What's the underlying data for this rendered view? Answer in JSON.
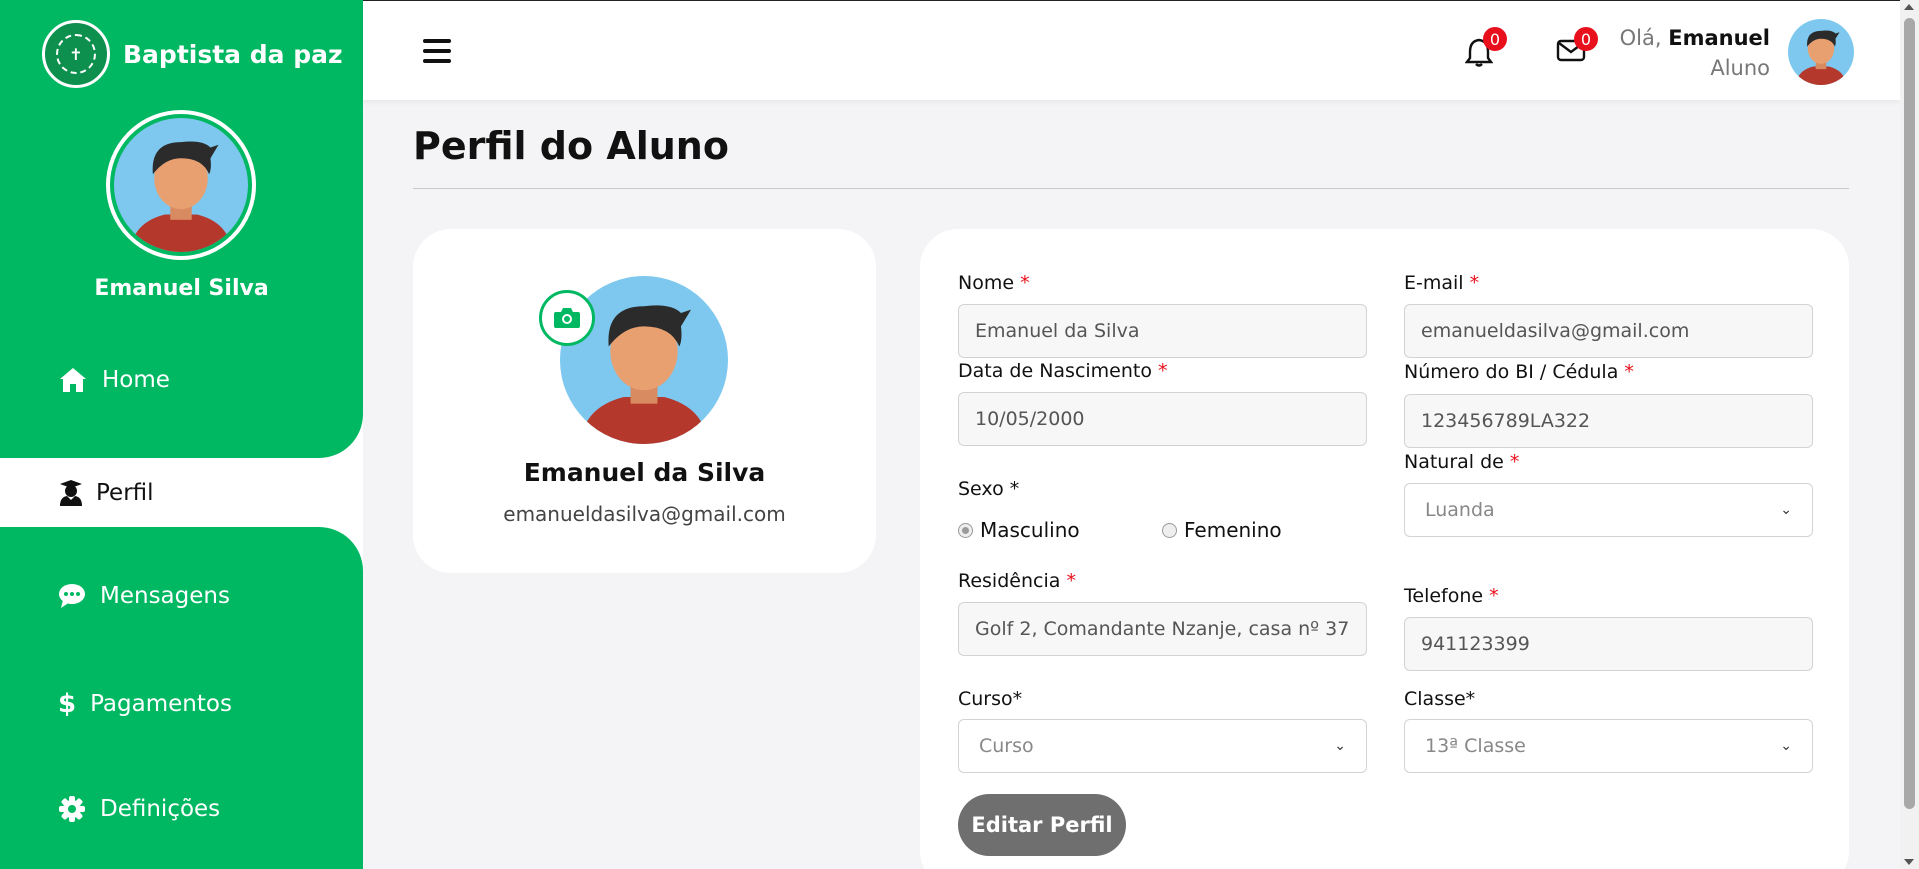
{
  "sidebar": {
    "brand_name": "Baptista da paz",
    "user_name": "Emanuel Silva",
    "items": [
      {
        "label": "Home",
        "icon": "home-icon"
      },
      {
        "label": "Perfil",
        "icon": "student-icon",
        "active": true
      },
      {
        "label": "Mensagens",
        "icon": "chat-icon"
      },
      {
        "label": "Pagamentos",
        "icon": "dollar-icon"
      },
      {
        "label": "Definições",
        "icon": "gear-icon"
      }
    ],
    "accent_color": "#00b862"
  },
  "topbar": {
    "notifications_count": "0",
    "messages_count": "0",
    "greeting": "Olá,",
    "user_first_name": "Emanuel",
    "user_role": "Aluno"
  },
  "page": {
    "title": "Perfil do Aluno"
  },
  "profile_card": {
    "name": "Emanuel da Silva",
    "email": "emanueldasilva@gmail.com"
  },
  "form": {
    "nome": {
      "label": "Nome",
      "value": "Emanuel da Silva"
    },
    "email": {
      "label": "E-mail",
      "value": "emanueldasilva@gmail.com"
    },
    "nascimento": {
      "label": "Data de Nascimento",
      "value": "10/05/2000"
    },
    "bi": {
      "label": "Número do BI / Cédula",
      "value": "123456789LA322"
    },
    "sexo": {
      "label": "Sexo *",
      "options": [
        "Masculino",
        "Femenino"
      ],
      "selected": "Masculino"
    },
    "natural": {
      "label": "Natural de",
      "value": "Luanda"
    },
    "residencia": {
      "label": "Residência",
      "value": "Golf 2, Comandante Nzanje, casa nº 37"
    },
    "telefone": {
      "label": "Telefone",
      "value": "941123399"
    },
    "curso": {
      "label": "Curso*",
      "value": "Curso"
    },
    "classe": {
      "label": "Classe*",
      "value": "13ª Classe"
    },
    "required_mark": "*",
    "submit_label": "Editar Perfil"
  }
}
